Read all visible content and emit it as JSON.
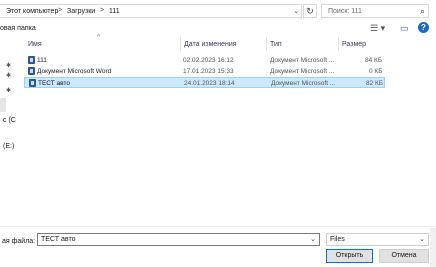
{
  "address": {
    "crumbs": [
      "Этот компьютер",
      "Загрузки",
      "111"
    ],
    "separator": ">",
    "dropdown_glyph": "⌄",
    "refresh_glyph": "↻"
  },
  "search": {
    "placeholder": "Поиск: 111",
    "icon": "search-icon"
  },
  "toolbar": {
    "new_folder_label": "овая папка",
    "view_glyph": "☰ ▾",
    "pane_glyph": "▭",
    "help_glyph": "?"
  },
  "columns": {
    "name": "Имя",
    "date": "Дата изменения",
    "type": "Тип",
    "size": "Размер"
  },
  "files": [
    {
      "name": "111",
      "date": "02.02.2023 16:12",
      "type": "Документ Microsoft ...",
      "size": "84 КБ",
      "selected": false
    },
    {
      "name": "Документ Microsoft Word",
      "date": "17.01.2023 15:33",
      "type": "Документ Microsoft ...",
      "size": "0 КБ",
      "selected": false
    },
    {
      "name": "ТЕСТ авто",
      "date": "24.01.2023 18:14",
      "type": "Документ Microsoft ...",
      "size": "82 КБ",
      "selected": true
    }
  ],
  "nav": {
    "item_c": "c (C",
    "item_e": "(E:)"
  },
  "footer": {
    "filename_label": "ая файла:",
    "filename_value": "ТЕСТ авто",
    "filetype_value": "Files",
    "open_label": "Открыть",
    "cancel_label": "Отмена"
  },
  "colors": {
    "selection": "#cce8ff",
    "selection_border": "#99d1ff",
    "word_icon": "#2b579a",
    "help": "#1b6ac9"
  }
}
